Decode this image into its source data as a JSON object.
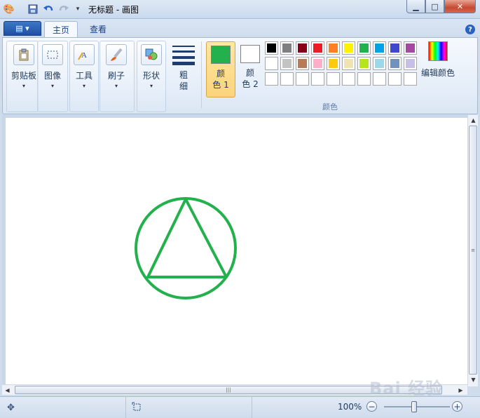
{
  "window": {
    "title": "无标题 - 画图"
  },
  "tabs": [
    {
      "label": "主页",
      "active": true
    },
    {
      "label": "查看",
      "active": false
    }
  ],
  "tools": [
    {
      "id": "clipboard",
      "label": "剪贴板"
    },
    {
      "id": "image",
      "label": "图像"
    },
    {
      "id": "tools",
      "label": "工具"
    },
    {
      "id": "brushes",
      "label": "刷子"
    },
    {
      "id": "shapes",
      "label": "形状"
    },
    {
      "id": "size",
      "label": "粗\n细"
    }
  ],
  "colors": {
    "color1": {
      "label": "颜\n色 1",
      "value": "#22b14c"
    },
    "color2": {
      "label": "颜\n色 2",
      "value": "#ffffff"
    },
    "edit_label": "编辑颜色",
    "group_label": "颜色",
    "palette_row1": [
      "#000000",
      "#7f7f7f",
      "#880015",
      "#ed1c24",
      "#ff7f27",
      "#fff200",
      "#22b14c",
      "#00a2e8",
      "#3f48cc",
      "#a349a4"
    ],
    "palette_row2": [
      "#ffffff",
      "#c3c3c3",
      "#b97a57",
      "#ffaec9",
      "#ffc90e",
      "#efe4b0",
      "#b5e61d",
      "#99d9ea",
      "#7092be",
      "#c8bfe7"
    ]
  },
  "canvas": {
    "stroke_color": "#22b14c"
  },
  "status": {
    "zoom": "100%"
  },
  "watermark": "Bai 经验"
}
